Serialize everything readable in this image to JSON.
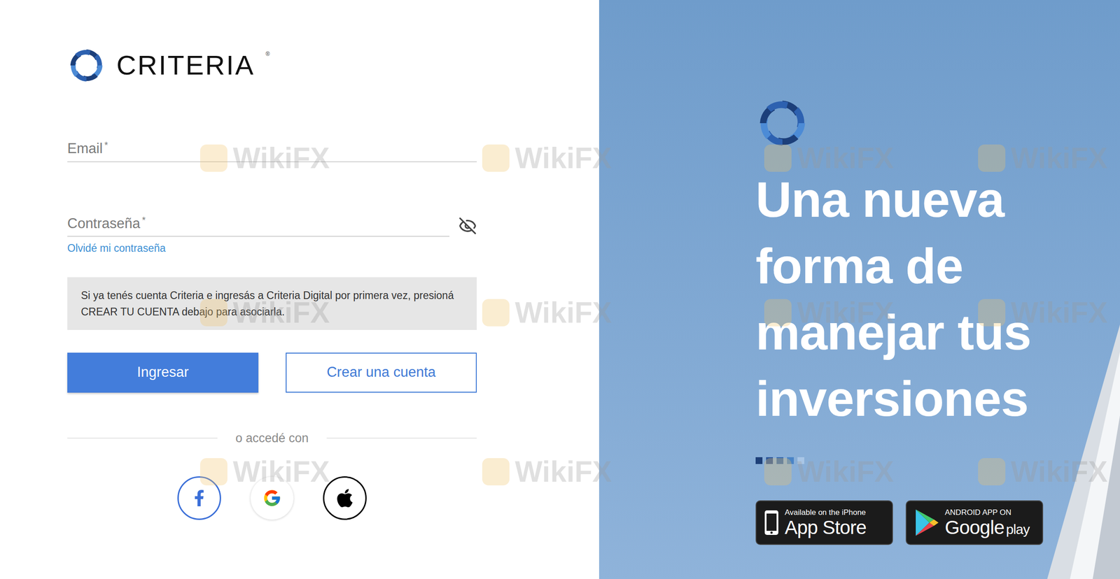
{
  "brand": {
    "name": "CRITERIA",
    "mark": "®"
  },
  "form": {
    "fields": [
      {
        "label": "Email",
        "required_mark": "*",
        "kind": "text"
      },
      {
        "label": "Contraseña",
        "required_mark": "*",
        "kind": "password"
      }
    ],
    "forgot_link": "Olvidé mi contraseña",
    "notice": "Si ya tenés cuenta Criteria e ingresás a Criteria Digital por primera vez, presioná CREAR TU CUENTA debajo para asociarla.",
    "buttons": [
      {
        "label": "Ingresar",
        "kind": "primary"
      },
      {
        "label": "Crear una cuenta",
        "kind": "secondary"
      }
    ],
    "divider": "o accedé con",
    "social": [
      {
        "kind": "facebook"
      },
      {
        "kind": "google"
      },
      {
        "kind": "apple"
      }
    ]
  },
  "hero": {
    "headline_lines": [
      "Una nueva",
      "forma de",
      "manejar tus",
      "inversiones"
    ],
    "slide_dots": [
      {
        "color": "#1d3f78"
      },
      {
        "color": "#2a559a"
      },
      {
        "color": "#3468ae"
      },
      {
        "color": "#4a84c6"
      },
      {
        "color": "#a9c6e6"
      }
    ],
    "stores": [
      {
        "kind": "apple",
        "small": "Available on the iPhone",
        "large": "App Store"
      },
      {
        "kind": "google",
        "small": "ANDROID APP ON",
        "large": "Google",
        "suffix": "play"
      }
    ]
  },
  "watermark": "WikiFX"
}
